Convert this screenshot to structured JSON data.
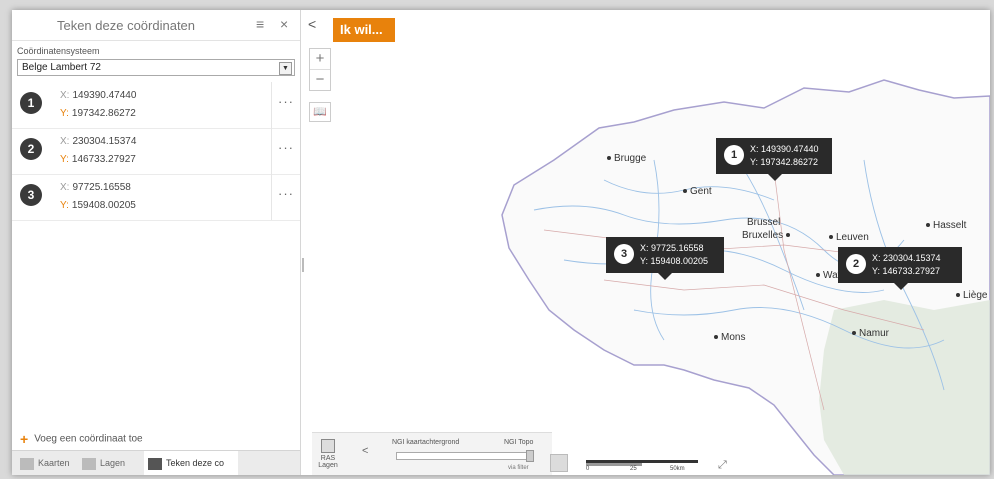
{
  "panel": {
    "title": "Teken deze coördinaten",
    "menu_icon": "≡",
    "close_icon": "×",
    "system_label": "Coördinatensysteem",
    "system_value": "Belge Lambert 72",
    "coords": [
      {
        "num": "1",
        "x_key": "X:",
        "x": "149390.47440",
        "y_key": "Y:",
        "y": "197342.86272"
      },
      {
        "num": "2",
        "x_key": "X:",
        "x": "230304.15374",
        "y_key": "Y:",
        "y": "146733.27927"
      },
      {
        "num": "3",
        "x_key": "X:",
        "x": "97725.16558",
        "y_key": "Y:",
        "y": "159408.00205"
      }
    ],
    "row_menu": "···",
    "add_label": "Voeg een coördinaat toe",
    "tabs": [
      "Kaarten",
      "Lagen",
      "Teken deze co"
    ]
  },
  "map": {
    "ikwil": "Ik wil...",
    "collapse": "<",
    "zoom_in": "+",
    "zoom_out": "−",
    "cities": [
      "Brugge",
      "Gent",
      "Brussel",
      "Bruxelles",
      "Leuven",
      "Hasselt",
      "Wavre",
      "Liège",
      "Mons",
      "Namur"
    ],
    "callouts": [
      {
        "num": "1",
        "x": "X: 149390.47440",
        "y": "Y: 197342.86272"
      },
      {
        "num": "2",
        "x": "X: 230304.15374",
        "y": "Y: 146733.27927"
      },
      {
        "num": "3",
        "x": "X: 97725.16558",
        "y": "Y: 159408.00205"
      }
    ],
    "bar": {
      "layers": "RAS Lagen",
      "chevron": "<",
      "left": "NGI kaartachtergrond",
      "right": "NGI Topo",
      "foot": "via filter"
    },
    "scale": {
      "t0": "0",
      "t1": "25",
      "t2": "50km"
    }
  },
  "colors": {
    "accent": "#e8820c",
    "dark": "#2a2a2a"
  }
}
